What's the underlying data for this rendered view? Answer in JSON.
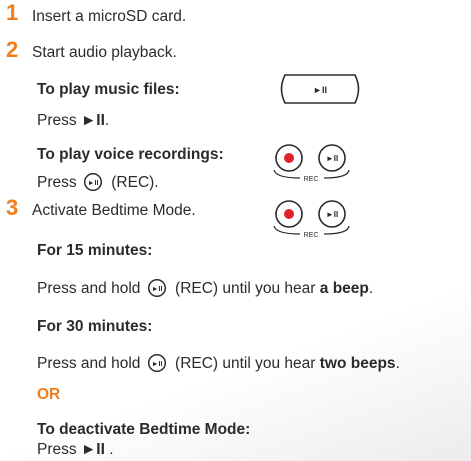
{
  "steps": [
    {
      "number": "1",
      "text": "Insert a microSD card."
    },
    {
      "number": "2",
      "text": "Start audio playback."
    },
    {
      "number": "3",
      "text": "Activate Bedtime Mode."
    }
  ],
  "music": {
    "heading": "To play music files:",
    "press": "Press",
    "key": "►II",
    "after": "."
  },
  "voice": {
    "heading": "To play voice recordings:",
    "press": "Press",
    "key_label": "(REC)."
  },
  "bedtime": {
    "min15_heading": "For 15 minutes:",
    "min15_press": "Press and hold",
    "min15_after": "(REC) until you hear",
    "min15_bold": "a beep",
    "min15_end": ".",
    "min30_heading": "For 30 minutes:",
    "min30_press": "Press and hold",
    "min30_after": "(REC) until you hear",
    "min30_bold": "two beeps",
    "min30_end": ".",
    "or": "OR",
    "deactivate_heading": "To deactivate Bedtime Mode:",
    "deactivate_press": "Press",
    "deactivate_key": "►II",
    "deactivate_after": "."
  },
  "device": {
    "play_glyph": "►II",
    "rec_label": "REC"
  },
  "colors": {
    "accent": "#f07d1a",
    "rec_dot": "#e0202a"
  }
}
